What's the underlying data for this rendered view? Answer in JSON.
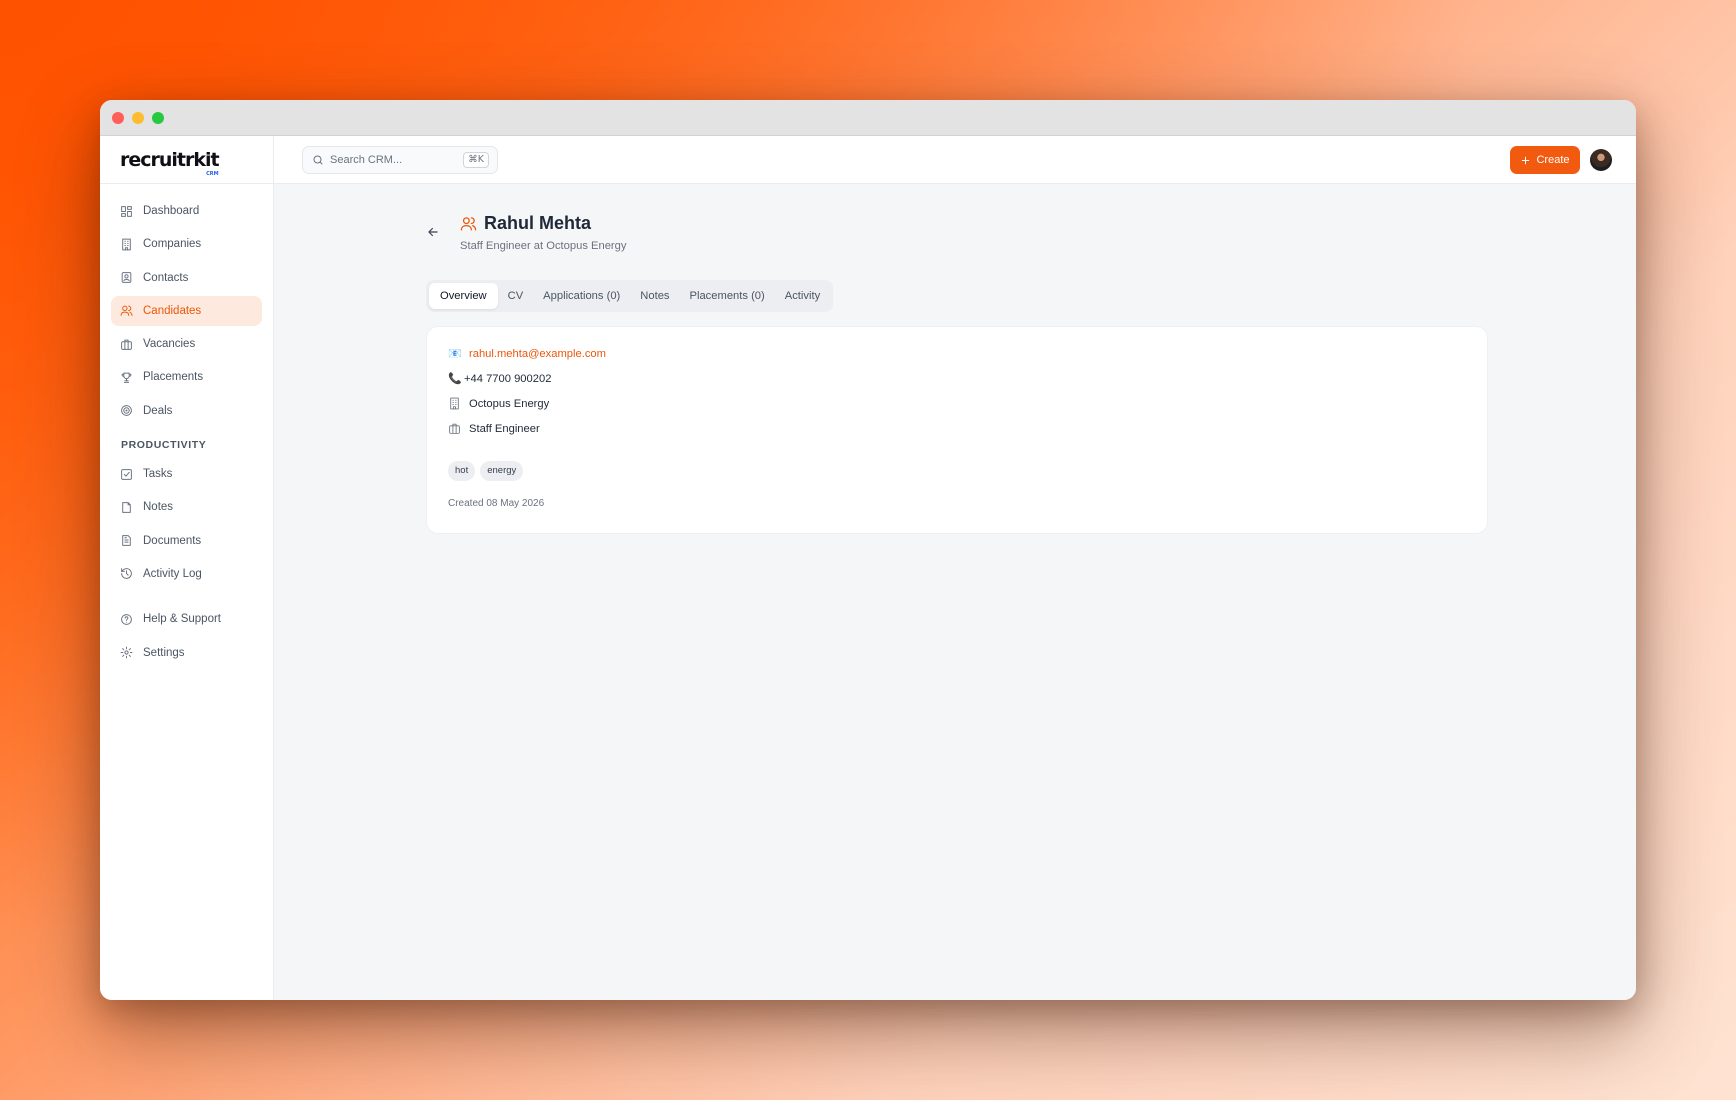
{
  "window": {
    "controls": {
      "close_color": "#ff5f57",
      "minimize_color": "#febc2e",
      "maximize_color": "#28c840"
    }
  },
  "brand": {
    "logo": "recruitrkit",
    "logo_sub": "CRM"
  },
  "search": {
    "placeholder": "Search CRM...",
    "shortcut": "⌘K"
  },
  "header_actions": {
    "create_label": "Create"
  },
  "sidebar": {
    "items": [
      {
        "label": "Dashboard",
        "icon": "dashboard-icon"
      },
      {
        "label": "Companies",
        "icon": "building-icon"
      },
      {
        "label": "Contacts",
        "icon": "contact-card-icon"
      },
      {
        "label": "Candidates",
        "icon": "users-icon",
        "active": true
      },
      {
        "label": "Vacancies",
        "icon": "briefcase-icon"
      },
      {
        "label": "Placements",
        "icon": "trophy-icon"
      },
      {
        "label": "Deals",
        "icon": "target-icon"
      }
    ],
    "productivity_heading": "PRODUCTIVITY",
    "productivity_items": [
      {
        "label": "Tasks",
        "icon": "checkbox-icon"
      },
      {
        "label": "Notes",
        "icon": "note-icon"
      },
      {
        "label": "Documents",
        "icon": "document-icon"
      },
      {
        "label": "Activity Log",
        "icon": "history-icon"
      }
    ],
    "footer_items": [
      {
        "label": "Help & Support",
        "icon": "help-icon"
      },
      {
        "label": "Settings",
        "icon": "gear-icon"
      }
    ]
  },
  "candidate": {
    "name": "Rahul Mehta",
    "subtitle": "Staff Engineer at Octopus Energy",
    "email": "rahul.mehta@example.com",
    "phone": "+44 7700 900202",
    "company": "Octopus Energy",
    "title": "Staff Engineer",
    "tags": [
      "hot",
      "energy"
    ],
    "created": "Created 08 May 2026"
  },
  "tabs": [
    "Overview",
    "CV",
    "Applications (0)",
    "Notes",
    "Placements (0)",
    "Activity"
  ],
  "active_tab": "Overview",
  "colors": {
    "accent": "#f25a0f",
    "active_bg": "#fde9dd"
  }
}
